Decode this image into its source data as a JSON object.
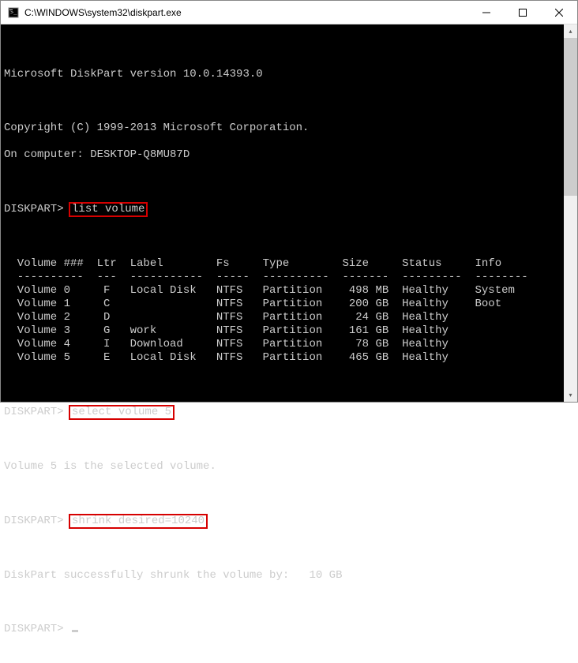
{
  "window": {
    "title": "C:\\WINDOWS\\system32\\diskpart.exe"
  },
  "console": {
    "version_line": "Microsoft DiskPart version 10.0.14393.0",
    "copyright_line": "Copyright (C) 1999-2013 Microsoft Corporation.",
    "computer_line": "On computer: DESKTOP-Q8MU87D",
    "prompt": "DISKPART> ",
    "cmd1": "list volume",
    "cmd2": "select volume 5",
    "cmd3": "shrink desired=10240",
    "selected_msg": "Volume 5 is the selected volume.",
    "shrink_msg": "DiskPart successfully shrunk the volume by:   10 GB",
    "headers": {
      "volume": "Volume ###",
      "ltr": "Ltr",
      "label": "Label",
      "fs": "Fs",
      "type": "Type",
      "size": "Size",
      "status": "Status",
      "info": "Info"
    },
    "dashes": {
      "volume": "----------",
      "ltr": "---",
      "label": "-----------",
      "fs": "-----",
      "type": "----------",
      "size": "-------",
      "status": "---------",
      "info": "--------"
    },
    "volumes": [
      {
        "vol": "Volume 0",
        "ltr": "F",
        "label": "Local Disk",
        "fs": "NTFS",
        "type": "Partition",
        "size": "498 MB",
        "status": "Healthy",
        "info": "System"
      },
      {
        "vol": "Volume 1",
        "ltr": "C",
        "label": "",
        "fs": "NTFS",
        "type": "Partition",
        "size": "200 GB",
        "status": "Healthy",
        "info": "Boot"
      },
      {
        "vol": "Volume 2",
        "ltr": "D",
        "label": "",
        "fs": "NTFS",
        "type": "Partition",
        "size": "24 GB",
        "status": "Healthy",
        "info": ""
      },
      {
        "vol": "Volume 3",
        "ltr": "G",
        "label": "work",
        "fs": "NTFS",
        "type": "Partition",
        "size": "161 GB",
        "status": "Healthy",
        "info": ""
      },
      {
        "vol": "Volume 4",
        "ltr": "I",
        "label": "Download",
        "fs": "NTFS",
        "type": "Partition",
        "size": "78 GB",
        "status": "Healthy",
        "info": ""
      },
      {
        "vol": "Volume 5",
        "ltr": "E",
        "label": "Local Disk",
        "fs": "NTFS",
        "type": "Partition",
        "size": "465 GB",
        "status": "Healthy",
        "info": ""
      }
    ]
  }
}
